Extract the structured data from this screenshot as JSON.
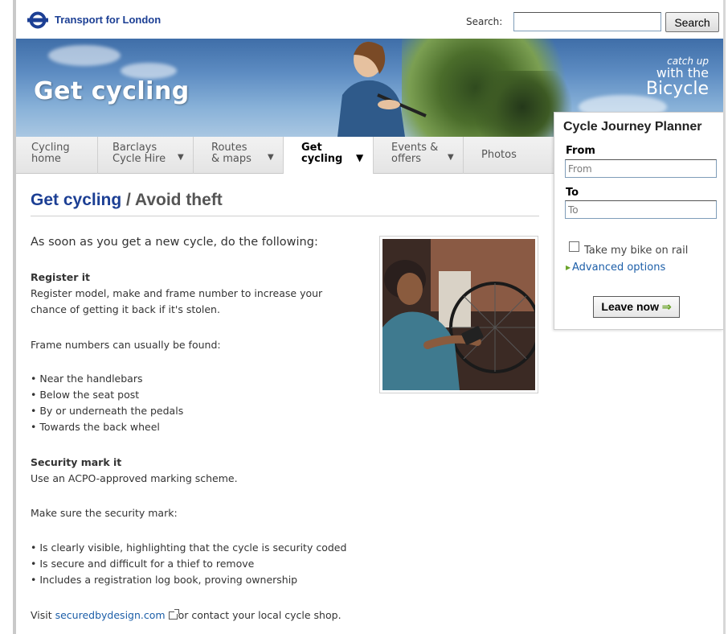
{
  "header": {
    "brand": "Transport for London",
    "search_label": "Search:",
    "search_value": "",
    "search_button": "Search"
  },
  "banner": {
    "title": "Get cycling",
    "tagline_1": "catch up",
    "tagline_2": "with the",
    "tagline_3": "Bicycle"
  },
  "nav": {
    "items": [
      {
        "line1": "Cycling",
        "line2": "home",
        "has_dropdown": false
      },
      {
        "line1": "Barclays",
        "line2": "Cycle Hire",
        "has_dropdown": true
      },
      {
        "line1": "Routes",
        "line2": "& maps",
        "has_dropdown": true
      },
      {
        "line1": "Get",
        "line2": "cycling",
        "has_dropdown": true,
        "active": true
      },
      {
        "line1": "Events &",
        "line2": "offers",
        "has_dropdown": true
      },
      {
        "line1": "Photos",
        "line2": "",
        "has_dropdown": false
      }
    ],
    "arrow": "▼"
  },
  "planner": {
    "title": "Cycle Journey Planner",
    "from_label": "From",
    "from_placeholder": "From",
    "to_label": "To",
    "to_placeholder": "To",
    "rail_label": "Take my bike on rail",
    "rail_checked": false,
    "advanced_link": "Advanced options",
    "leave_button": "Leave now",
    "leave_arrow": "⇒"
  },
  "content": {
    "title_link": "Get cycling",
    "title_rest": " / Avoid theft",
    "intro": "As soon as you get a new cycle, do the following:",
    "register_heading": "Register it",
    "register_line1": "Register model, make and frame number to increase your",
    "register_line2": "chance of getting it back if it's stolen.",
    "frame_intro": "Frame numbers can usually be found:",
    "frame_items": [
      "• Near the handlebars",
      "• Below the seat post",
      "• By or underneath the pedals",
      "• Towards the back wheel"
    ],
    "security_heading": "Security mark it",
    "security_line": "Use an ACPO-approved marking scheme.",
    "mark_intro": "Make sure the security mark:",
    "mark_items": [
      "• Is clearly visible, highlighting that the cycle is security coded",
      "• Is secure and difficult for a thief to remove",
      "• Includes a registration log book, proving ownership"
    ],
    "visit_prefix": "Visit ",
    "visit_link": "securedbydesign.com",
    "visit_suffix": "or contact your local cycle shop."
  },
  "colors": {
    "brand_blue": "#1c3f94",
    "link_blue": "#1c5ea8",
    "go_green": "#6aa329"
  }
}
